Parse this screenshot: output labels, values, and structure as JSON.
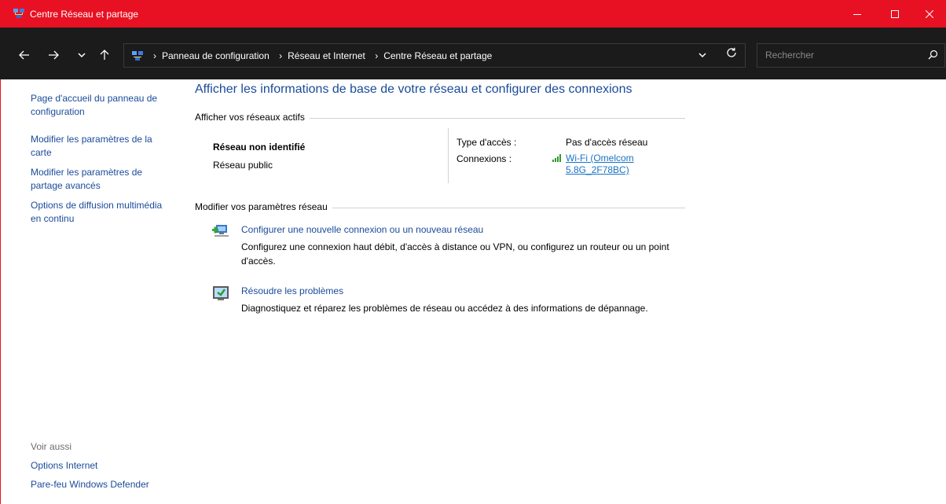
{
  "window": {
    "title": "Centre Réseau et partage"
  },
  "nav": {
    "breadcrumb": [
      "Panneau de configuration",
      "Réseau et Internet",
      "Centre Réseau et partage"
    ],
    "search_placeholder": "Rechercher"
  },
  "sidebar": {
    "links": [
      "Page d'accueil du panneau de configuration",
      "Modifier les paramètres de la carte",
      "Modifier les paramètres de partage avancés",
      "Options de diffusion multimédia en continu"
    ]
  },
  "see_also": {
    "label": "Voir aussi",
    "links": [
      "Options Internet",
      "Pare-feu Windows Defender"
    ]
  },
  "main": {
    "title": "Afficher les informations de base de votre réseau et configurer des connexions",
    "active_section": "Afficher vos réseaux actifs",
    "network": {
      "name": "Réseau non identifié",
      "category": "Réseau public",
      "access_type_label": "Type d'accès :",
      "access_type_value": "Pas d'accès réseau",
      "connections_label": "Connexions :",
      "connection_line1": "Wi-Fi (Omelcom",
      "connection_line2": "5.8G_2F78BC)"
    },
    "settings_section": "Modifier vos paramètres réseau",
    "tasks": [
      {
        "link": "Configurer une nouvelle connexion ou un nouveau réseau",
        "desc": "Configurez une connexion haut débit, d'accès à distance ou VPN, ou configurez un routeur ou un point d'accès."
      },
      {
        "link": "Résoudre les problèmes",
        "desc": "Diagnostiquez et réparez les problèmes de réseau ou accédez à des informations de dépannage."
      }
    ]
  },
  "colors": {
    "titlebar": "#e81123",
    "navbar": "#1b1b1b",
    "link": "#1a4b9a"
  }
}
